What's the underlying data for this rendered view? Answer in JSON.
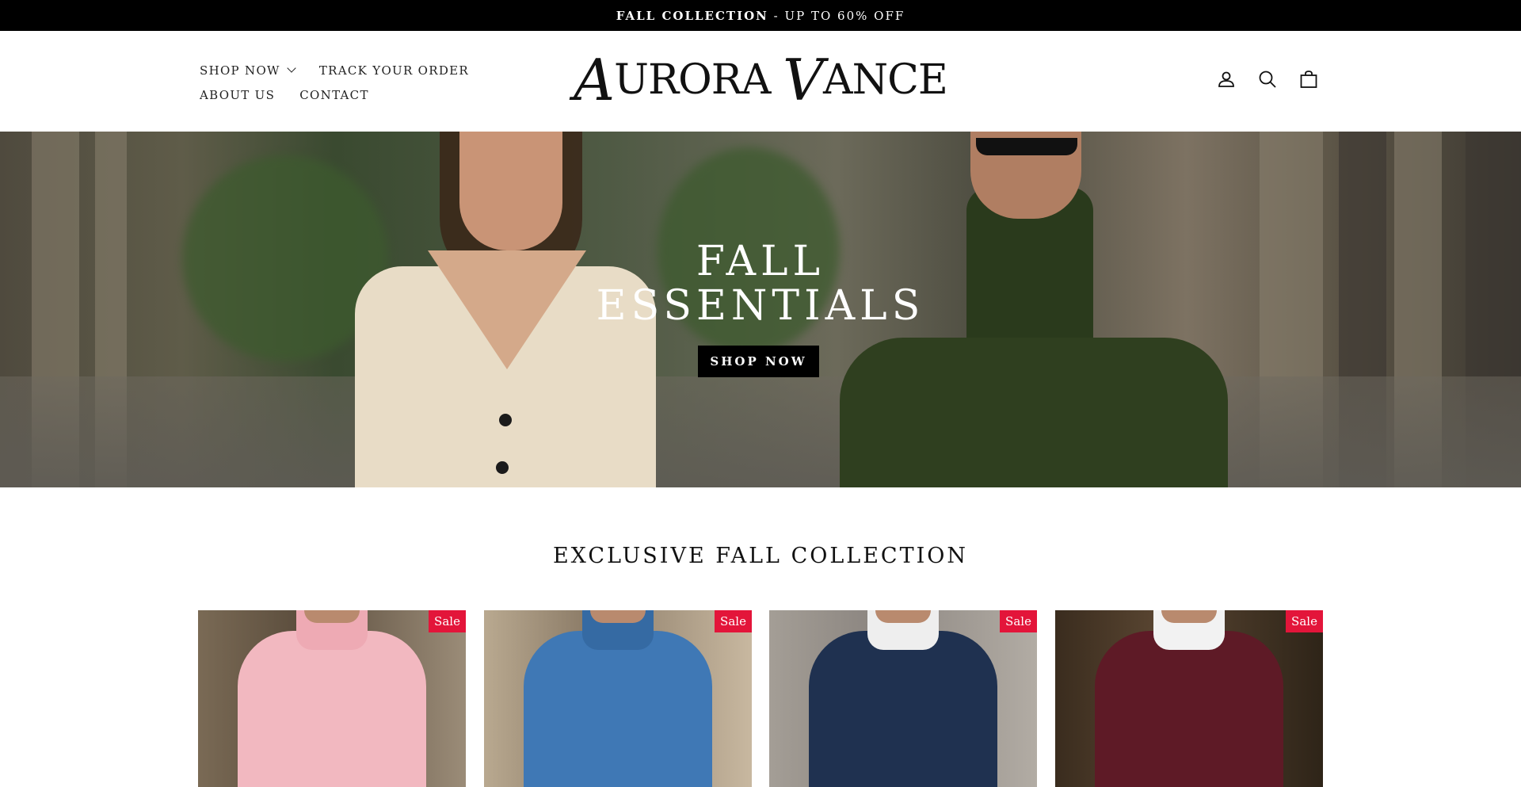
{
  "announcement": {
    "bold": "FALL COLLECTION",
    "rest": " - UP TO 60% OFF"
  },
  "nav": {
    "items": [
      {
        "label": "SHOP NOW",
        "has_dropdown": true
      },
      {
        "label": "TRACK YOUR ORDER"
      },
      {
        "label": "ABOUT US"
      },
      {
        "label": "CONTACT"
      }
    ]
  },
  "brand": {
    "first_initial": "A",
    "first_rest": "URORA",
    "second_initial": "V",
    "second_rest": "ANCE"
  },
  "header_icons": [
    "account-icon",
    "search-icon",
    "cart-icon"
  ],
  "hero": {
    "title_line1": "FALL",
    "title_line2": "ESSENTIALS",
    "cta": "SHOP NOW"
  },
  "collection": {
    "title": "EXCLUSIVE FALL COLLECTION",
    "products": [
      {
        "badge": "Sale",
        "color": "#f2b8c0",
        "bg": "#6b5a48"
      },
      {
        "badge": "Sale",
        "color": "#3f78b5",
        "bg": "#8a7a66"
      },
      {
        "badge": "Sale",
        "color": "#1f3150",
        "bg": "#8b8580"
      },
      {
        "badge": "Sale",
        "color": "#5e1a26",
        "bg": "#4b3b2a"
      }
    ]
  },
  "colors": {
    "sale_badge": "#e3153a",
    "announcement_bg": "#000000",
    "cta_bg": "#000000"
  }
}
